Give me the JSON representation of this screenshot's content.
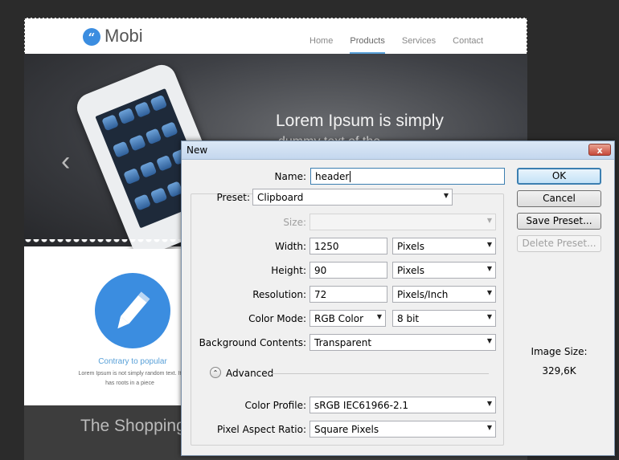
{
  "site": {
    "logo_text": "Mobi",
    "logo_mark": "“",
    "nav": [
      "Home",
      "Products",
      "Services",
      "Contact"
    ],
    "hero_title": "Lorem Ipsum is simply",
    "hero_subtitle": "dummy text of the",
    "prev_arrow": "‹",
    "feature_title": "Contrary to popular",
    "feature_text": "Lorem Ipsum is not simply random text. It has roots in a piece",
    "band_title": "The Shopping"
  },
  "dialog": {
    "title": "New",
    "close_label": "x",
    "name_label": "Name:",
    "name_value": "header",
    "preset_label": "Preset:",
    "preset_value": "Clipboard",
    "size_label": "Size:",
    "size_value": "",
    "width_label": "Width:",
    "width_value": "1250",
    "width_unit": "Pixels",
    "height_label": "Height:",
    "height_value": "90",
    "height_unit": "Pixels",
    "resolution_label": "Resolution:",
    "resolution_value": "72",
    "resolution_unit": "Pixels/Inch",
    "color_mode_label": "Color Mode:",
    "color_mode_value": "RGB Color",
    "bit_depth_value": "8 bit",
    "background_label": "Background Contents:",
    "background_value": "Transparent",
    "advanced_label": "Advanced",
    "color_profile_label": "Color Profile:",
    "color_profile_value": "sRGB IEC61966-2.1",
    "pixel_aspect_label": "Pixel Aspect Ratio:",
    "pixel_aspect_value": "Square Pixels",
    "ok_label": "OK",
    "cancel_label": "Cancel",
    "save_preset_label": "Save Preset...",
    "delete_preset_label": "Delete Preset...",
    "image_size_label": "Image Size:",
    "image_size_value": "329,6K"
  }
}
